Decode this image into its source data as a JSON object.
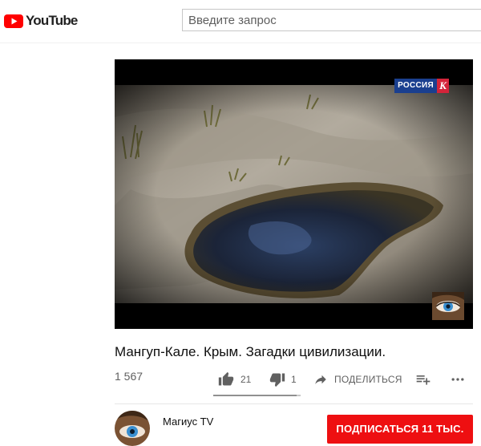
{
  "header": {
    "logo_text": "YouTube",
    "search_placeholder": "Введите запрос"
  },
  "player": {
    "channel_badge": "РОССИЯ",
    "channel_badge_letter": "К"
  },
  "video": {
    "title": "Мангуп-Кале. Крым. Загадки цивилизации.",
    "views": "1 567",
    "likes": "21",
    "dislikes": "1",
    "share_label": "ПОДЕЛИТЬСЯ",
    "like_ratio": 0.95
  },
  "channel": {
    "name": "Магиус TV",
    "subscribe_label": "ПОДПИСАТЬСЯ  11 ТЫС."
  },
  "icons": {
    "logo": "youtube-logo-icon",
    "like": "thumbs-up-icon",
    "dislike": "thumbs-down-icon",
    "share": "share-arrow-icon",
    "save": "add-to-playlist-icon",
    "more": "more-horizontal-icon"
  },
  "colors": {
    "brand_red": "#ff0000",
    "subscribe_red": "#ee0f11",
    "text_secondary": "#606060"
  }
}
